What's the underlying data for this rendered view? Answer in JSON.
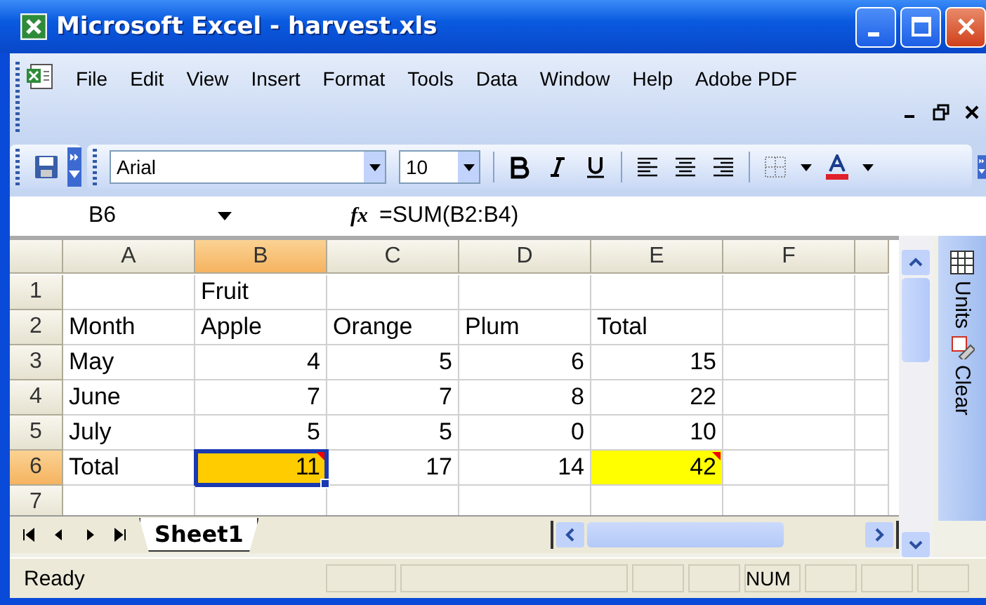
{
  "window": {
    "title": "Microsoft Excel - harvest.xls"
  },
  "menu": [
    "File",
    "Edit",
    "View",
    "Insert",
    "Format",
    "Tools",
    "Data",
    "Window",
    "Help",
    "Adobe PDF"
  ],
  "toolbar": {
    "font": "Arial",
    "size": "10"
  },
  "formula_bar": {
    "name_box": "B6",
    "function_label": "fx",
    "formula": "=SUM(B2:B4)"
  },
  "columns": [
    {
      "label": "A",
      "selected": false
    },
    {
      "label": "B",
      "selected": true
    },
    {
      "label": "C",
      "selected": false
    },
    {
      "label": "D",
      "selected": false
    },
    {
      "label": "E",
      "selected": false
    },
    {
      "label": "F",
      "selected": false
    }
  ],
  "rows": [
    {
      "header": "1",
      "selected": false,
      "cells": [
        {
          "selected": false
        },
        {
          "value": "Fruit",
          "kind": "text",
          "selected": false
        },
        {
          "selected": false
        },
        {
          "selected": false
        },
        {
          "selected": false
        },
        {
          "selected": false
        }
      ]
    },
    {
      "header": "2",
      "selected": false,
      "cells": [
        {
          "value": "Month",
          "kind": "text",
          "selected": false
        },
        {
          "value": "Apple",
          "kind": "text",
          "selected": false
        },
        {
          "value": "Orange",
          "kind": "text",
          "selected": false
        },
        {
          "value": "Plum",
          "kind": "text",
          "selected": false
        },
        {
          "value": "Total",
          "kind": "text",
          "selected": false
        },
        {
          "selected": false
        }
      ]
    },
    {
      "header": "3",
      "selected": false,
      "cells": [
        {
          "value": "May",
          "kind": "text",
          "selected": false
        },
        {
          "value": "4",
          "kind": "number",
          "selected": false
        },
        {
          "value": "5",
          "kind": "number",
          "selected": false
        },
        {
          "value": "6",
          "kind": "number",
          "selected": false
        },
        {
          "value": "15",
          "kind": "number",
          "selected": false
        },
        {
          "selected": false
        }
      ]
    },
    {
      "header": "4",
      "selected": false,
      "cells": [
        {
          "value": "June",
          "kind": "text",
          "selected": false
        },
        {
          "value": "7",
          "kind": "number",
          "selected": false
        },
        {
          "value": "7",
          "kind": "number",
          "selected": false
        },
        {
          "value": "8",
          "kind": "number",
          "selected": false
        },
        {
          "value": "22",
          "kind": "number",
          "selected": false
        },
        {
          "selected": false
        }
      ]
    },
    {
      "header": "5",
      "selected": false,
      "cells": [
        {
          "value": "July",
          "kind": "text",
          "selected": false
        },
        {
          "value": "5",
          "kind": "number",
          "selected": false
        },
        {
          "value": "5",
          "kind": "number",
          "selected": false
        },
        {
          "value": "0",
          "kind": "number",
          "selected": false
        },
        {
          "value": "10",
          "kind": "number",
          "selected": false
        },
        {
          "selected": false
        }
      ]
    },
    {
      "header": "6",
      "selected": true,
      "cells": [
        {
          "value": "Total",
          "kind": "text",
          "selected": false
        },
        {
          "value": "11",
          "kind": "number",
          "selected": true,
          "color": "#ffcc00",
          "comment": true
        },
        {
          "value": "17",
          "kind": "number",
          "selected": false
        },
        {
          "value": "14",
          "kind": "number",
          "selected": false
        },
        {
          "value": "42",
          "kind": "number",
          "selected": false,
          "color": "#ffff00",
          "comment": true
        },
        {
          "selected": false
        }
      ]
    },
    {
      "header": "7",
      "selected": false,
      "cells": [
        {
          "selected": false
        },
        {
          "selected": false
        },
        {
          "selected": false
        },
        {
          "selected": false
        },
        {
          "selected": false
        },
        {
          "selected": false
        }
      ]
    }
  ],
  "side_panel": [
    "Units",
    "Clear"
  ],
  "sheet_tabs": [
    {
      "label": "Sheet1",
      "selected": true
    }
  ],
  "status_bar": {
    "text": "Ready",
    "indicator": "NUM"
  }
}
